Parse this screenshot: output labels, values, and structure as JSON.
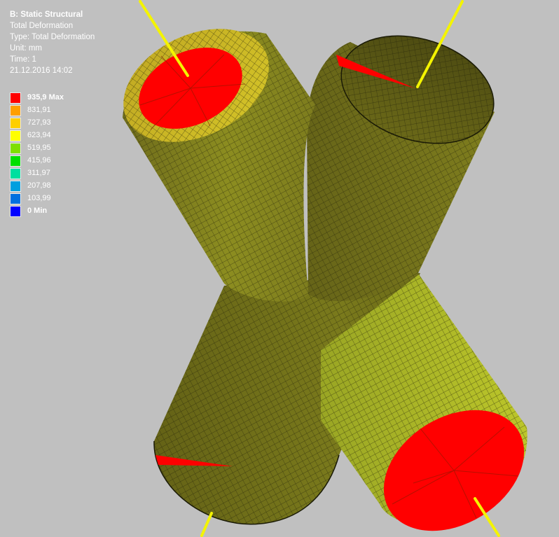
{
  "window": {
    "title": "B: Static Structural",
    "lines": [
      "Total Deformation",
      "Type: Total Deformation",
      "Unit: mm",
      "Time: 1",
      "21.12.2016 14:02"
    ]
  },
  "legend": [
    {
      "label": "935,9 Max",
      "color": "#ff0000",
      "bold": true
    },
    {
      "label": "831,91",
      "color": "#ff9f00",
      "bold": false
    },
    {
      "label": "727,93",
      "color": "#ffcf00",
      "bold": false
    },
    {
      "label": "623,94",
      "color": "#ffff00",
      "bold": false
    },
    {
      "label": "519,95",
      "color": "#7fdf00",
      "bold": false
    },
    {
      "label": "415,96",
      "color": "#00df00",
      "bold": false
    },
    {
      "label": "311,97",
      "color": "#00df9f",
      "bold": false
    },
    {
      "label": "207,98",
      "color": "#009fdf",
      "bold": false
    },
    {
      "label": "103,99",
      "color": "#0070df",
      "bold": false
    },
    {
      "label": "0 Min",
      "color": "#0000ff",
      "bold": true
    }
  ],
  "colors": {
    "background": "#c0c0c0",
    "body_dark": "#6f6c1c",
    "body_light": "#b8c22a",
    "deform_max": "#ff0000",
    "axis_line": "#f4f400"
  }
}
